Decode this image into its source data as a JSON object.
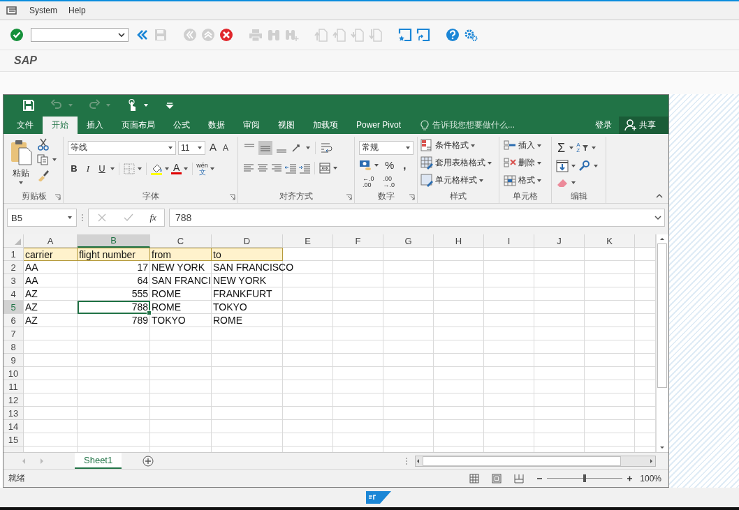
{
  "sap_menu": [
    {
      "label": "System"
    },
    {
      "label": "Help"
    }
  ],
  "sap_toolbar": [
    {
      "kind": "enter",
      "disabled": false
    },
    {
      "kind": "command_field"
    },
    {
      "kind": "back",
      "disabled": false
    },
    {
      "kind": "save",
      "disabled": true
    },
    {
      "kind": "separator"
    },
    {
      "kind": "exit",
      "disabled": true
    },
    {
      "kind": "up",
      "disabled": true
    },
    {
      "kind": "cancel",
      "disabled": false
    },
    {
      "kind": "separator"
    },
    {
      "kind": "print",
      "disabled": true
    },
    {
      "kind": "find",
      "disabled": true
    },
    {
      "kind": "find_next",
      "disabled": true
    },
    {
      "kind": "separator"
    },
    {
      "kind": "first_page",
      "disabled": true
    },
    {
      "kind": "prev_page",
      "disabled": true
    },
    {
      "kind": "next_page",
      "disabled": true
    },
    {
      "kind": "last_page",
      "disabled": true
    },
    {
      "kind": "separator"
    },
    {
      "kind": "new_session",
      "disabled": false
    },
    {
      "kind": "shortcut",
      "disabled": false
    },
    {
      "kind": "separator"
    },
    {
      "kind": "help",
      "disabled": false
    },
    {
      "kind": "settings",
      "disabled": false
    }
  ],
  "sap_title": "SAP",
  "excel": {
    "quick_access": [
      {
        "kind": "save",
        "disabled": false
      },
      {
        "kind": "undo",
        "disabled": true
      },
      {
        "kind": "redo",
        "disabled": true
      },
      {
        "kind": "touch_mode",
        "disabled": false
      },
      {
        "kind": "customize",
        "disabled": false
      }
    ],
    "tabs": [
      {
        "label": "文件",
        "selected": false
      },
      {
        "label": "开始",
        "selected": true
      },
      {
        "label": "插入",
        "selected": false
      },
      {
        "label": "页面布局",
        "selected": false
      },
      {
        "label": "公式",
        "selected": false
      },
      {
        "label": "数据",
        "selected": false
      },
      {
        "label": "审阅",
        "selected": false
      },
      {
        "label": "视图",
        "selected": false
      },
      {
        "label": "加载项",
        "selected": false
      },
      {
        "label": "Power Pivot",
        "selected": false
      }
    ],
    "tell_me": "告诉我您想要做什么...",
    "sign_in": "登录",
    "share": "共享",
    "ribbon": {
      "clipboard": {
        "paste": "粘贴",
        "label": "剪贴板"
      },
      "font": {
        "name": "等线",
        "size": "11",
        "grow": "A",
        "shrink": "A",
        "styles": [
          {
            "label": "B",
            "kind": "bold"
          },
          {
            "label": "I",
            "kind": "italic"
          },
          {
            "label": "U",
            "kind": "underline"
          }
        ],
        "font_color": "A",
        "phonetic": [
          "wén",
          "文"
        ],
        "label": "字体"
      },
      "alignment": {
        "buttons": [
          {
            "kind": "top",
            "selected": false
          },
          {
            "kind": "middle",
            "selected": true
          },
          {
            "kind": "bottom",
            "selected": false
          }
        ],
        "label": "对齐方式"
      },
      "number": {
        "format": "常规",
        "percent": "%",
        "comma": ",",
        "decimals": [
          [
            "←.0",
            ".00"
          ],
          [
            ".00",
            "→.0"
          ]
        ],
        "label": "数字"
      },
      "styles": {
        "items": [
          "条件格式",
          "套用表格格式",
          "单元格样式"
        ],
        "label": "样式"
      },
      "cells": {
        "items": [
          "插入",
          "删除",
          "格式"
        ],
        "label": "单元格"
      },
      "editing": {
        "sum": "Σ",
        "sort": [
          "A",
          "Z"
        ],
        "label": "编辑"
      }
    },
    "name_box": "B5",
    "fx": "fx",
    "formula": "788",
    "columns": [
      {
        "label": "A",
        "selected": false
      },
      {
        "label": "B",
        "selected": true
      },
      {
        "label": "C",
        "selected": false
      },
      {
        "label": "D",
        "selected": false
      },
      {
        "label": "E",
        "selected": false
      },
      {
        "label": "F",
        "selected": false
      },
      {
        "label": "G",
        "selected": false
      },
      {
        "label": "H",
        "selected": false
      },
      {
        "label": "I",
        "selected": false
      },
      {
        "label": "J",
        "selected": false
      },
      {
        "label": "K",
        "selected": false
      }
    ],
    "rows": [
      {
        "label": "1",
        "kind": "header",
        "selected": false,
        "cells": [
          {
            "text": "carrier",
            "kind": "text",
            "selected": false
          },
          {
            "text": "flight number",
            "kind": "text",
            "selected": false
          },
          {
            "text": "from",
            "kind": "text",
            "selected": false
          },
          {
            "text": "to",
            "kind": "text",
            "selected": false
          }
        ]
      },
      {
        "label": "2",
        "kind": "data",
        "selected": false,
        "cells": [
          {
            "text": "AA",
            "kind": "text",
            "selected": false
          },
          {
            "text": "17",
            "kind": "number",
            "selected": false
          },
          {
            "text": "NEW YORK",
            "kind": "text",
            "selected": false
          },
          {
            "text": "SAN FRANCISCO",
            "kind": "text",
            "selected": false
          }
        ]
      },
      {
        "label": "3",
        "kind": "data",
        "selected": false,
        "cells": [
          {
            "text": "AA",
            "kind": "text",
            "selected": false
          },
          {
            "text": "64",
            "kind": "number",
            "selected": false
          },
          {
            "text": "SAN FRANCI",
            "kind": "text",
            "selected": false
          },
          {
            "text": "NEW YORK",
            "kind": "text",
            "selected": false
          }
        ]
      },
      {
        "label": "4",
        "kind": "data",
        "selected": false,
        "cells": [
          {
            "text": "AZ",
            "kind": "text",
            "selected": false
          },
          {
            "text": "555",
            "kind": "number",
            "selected": false
          },
          {
            "text": "ROME",
            "kind": "text",
            "selected": false
          },
          {
            "text": "FRANKFURT",
            "kind": "text",
            "selected": false
          }
        ]
      },
      {
        "label": "5",
        "kind": "data",
        "selected": true,
        "cells": [
          {
            "text": "AZ",
            "kind": "text",
            "selected": false
          },
          {
            "text": "788",
            "kind": "number",
            "selected": true
          },
          {
            "text": "ROME",
            "kind": "text",
            "selected": false
          },
          {
            "text": "TOKYO",
            "kind": "text",
            "selected": false
          }
        ]
      },
      {
        "label": "6",
        "kind": "data",
        "selected": false,
        "cells": [
          {
            "text": "AZ",
            "kind": "text",
            "selected": false
          },
          {
            "text": "789",
            "kind": "number",
            "selected": false
          },
          {
            "text": "TOKYO",
            "kind": "text",
            "selected": false
          },
          {
            "text": "ROME",
            "kind": "text",
            "selected": false
          }
        ]
      },
      {
        "label": "7",
        "selected": false,
        "cells": []
      },
      {
        "label": "8",
        "selected": false,
        "cells": []
      },
      {
        "label": "9",
        "selected": false,
        "cells": []
      },
      {
        "label": "10",
        "selected": false,
        "cells": []
      },
      {
        "label": "11",
        "selected": false,
        "cells": []
      },
      {
        "label": "12",
        "selected": false,
        "cells": []
      },
      {
        "label": "13",
        "selected": false,
        "cells": []
      },
      {
        "label": "14",
        "selected": false,
        "cells": []
      },
      {
        "label": "15",
        "selected": false,
        "cells": []
      }
    ],
    "sheets": [
      {
        "label": "Sheet1",
        "selected": true
      }
    ],
    "status": "就绪",
    "zoom_slider": {
      "level": 0.5
    },
    "zoom": "100%"
  }
}
